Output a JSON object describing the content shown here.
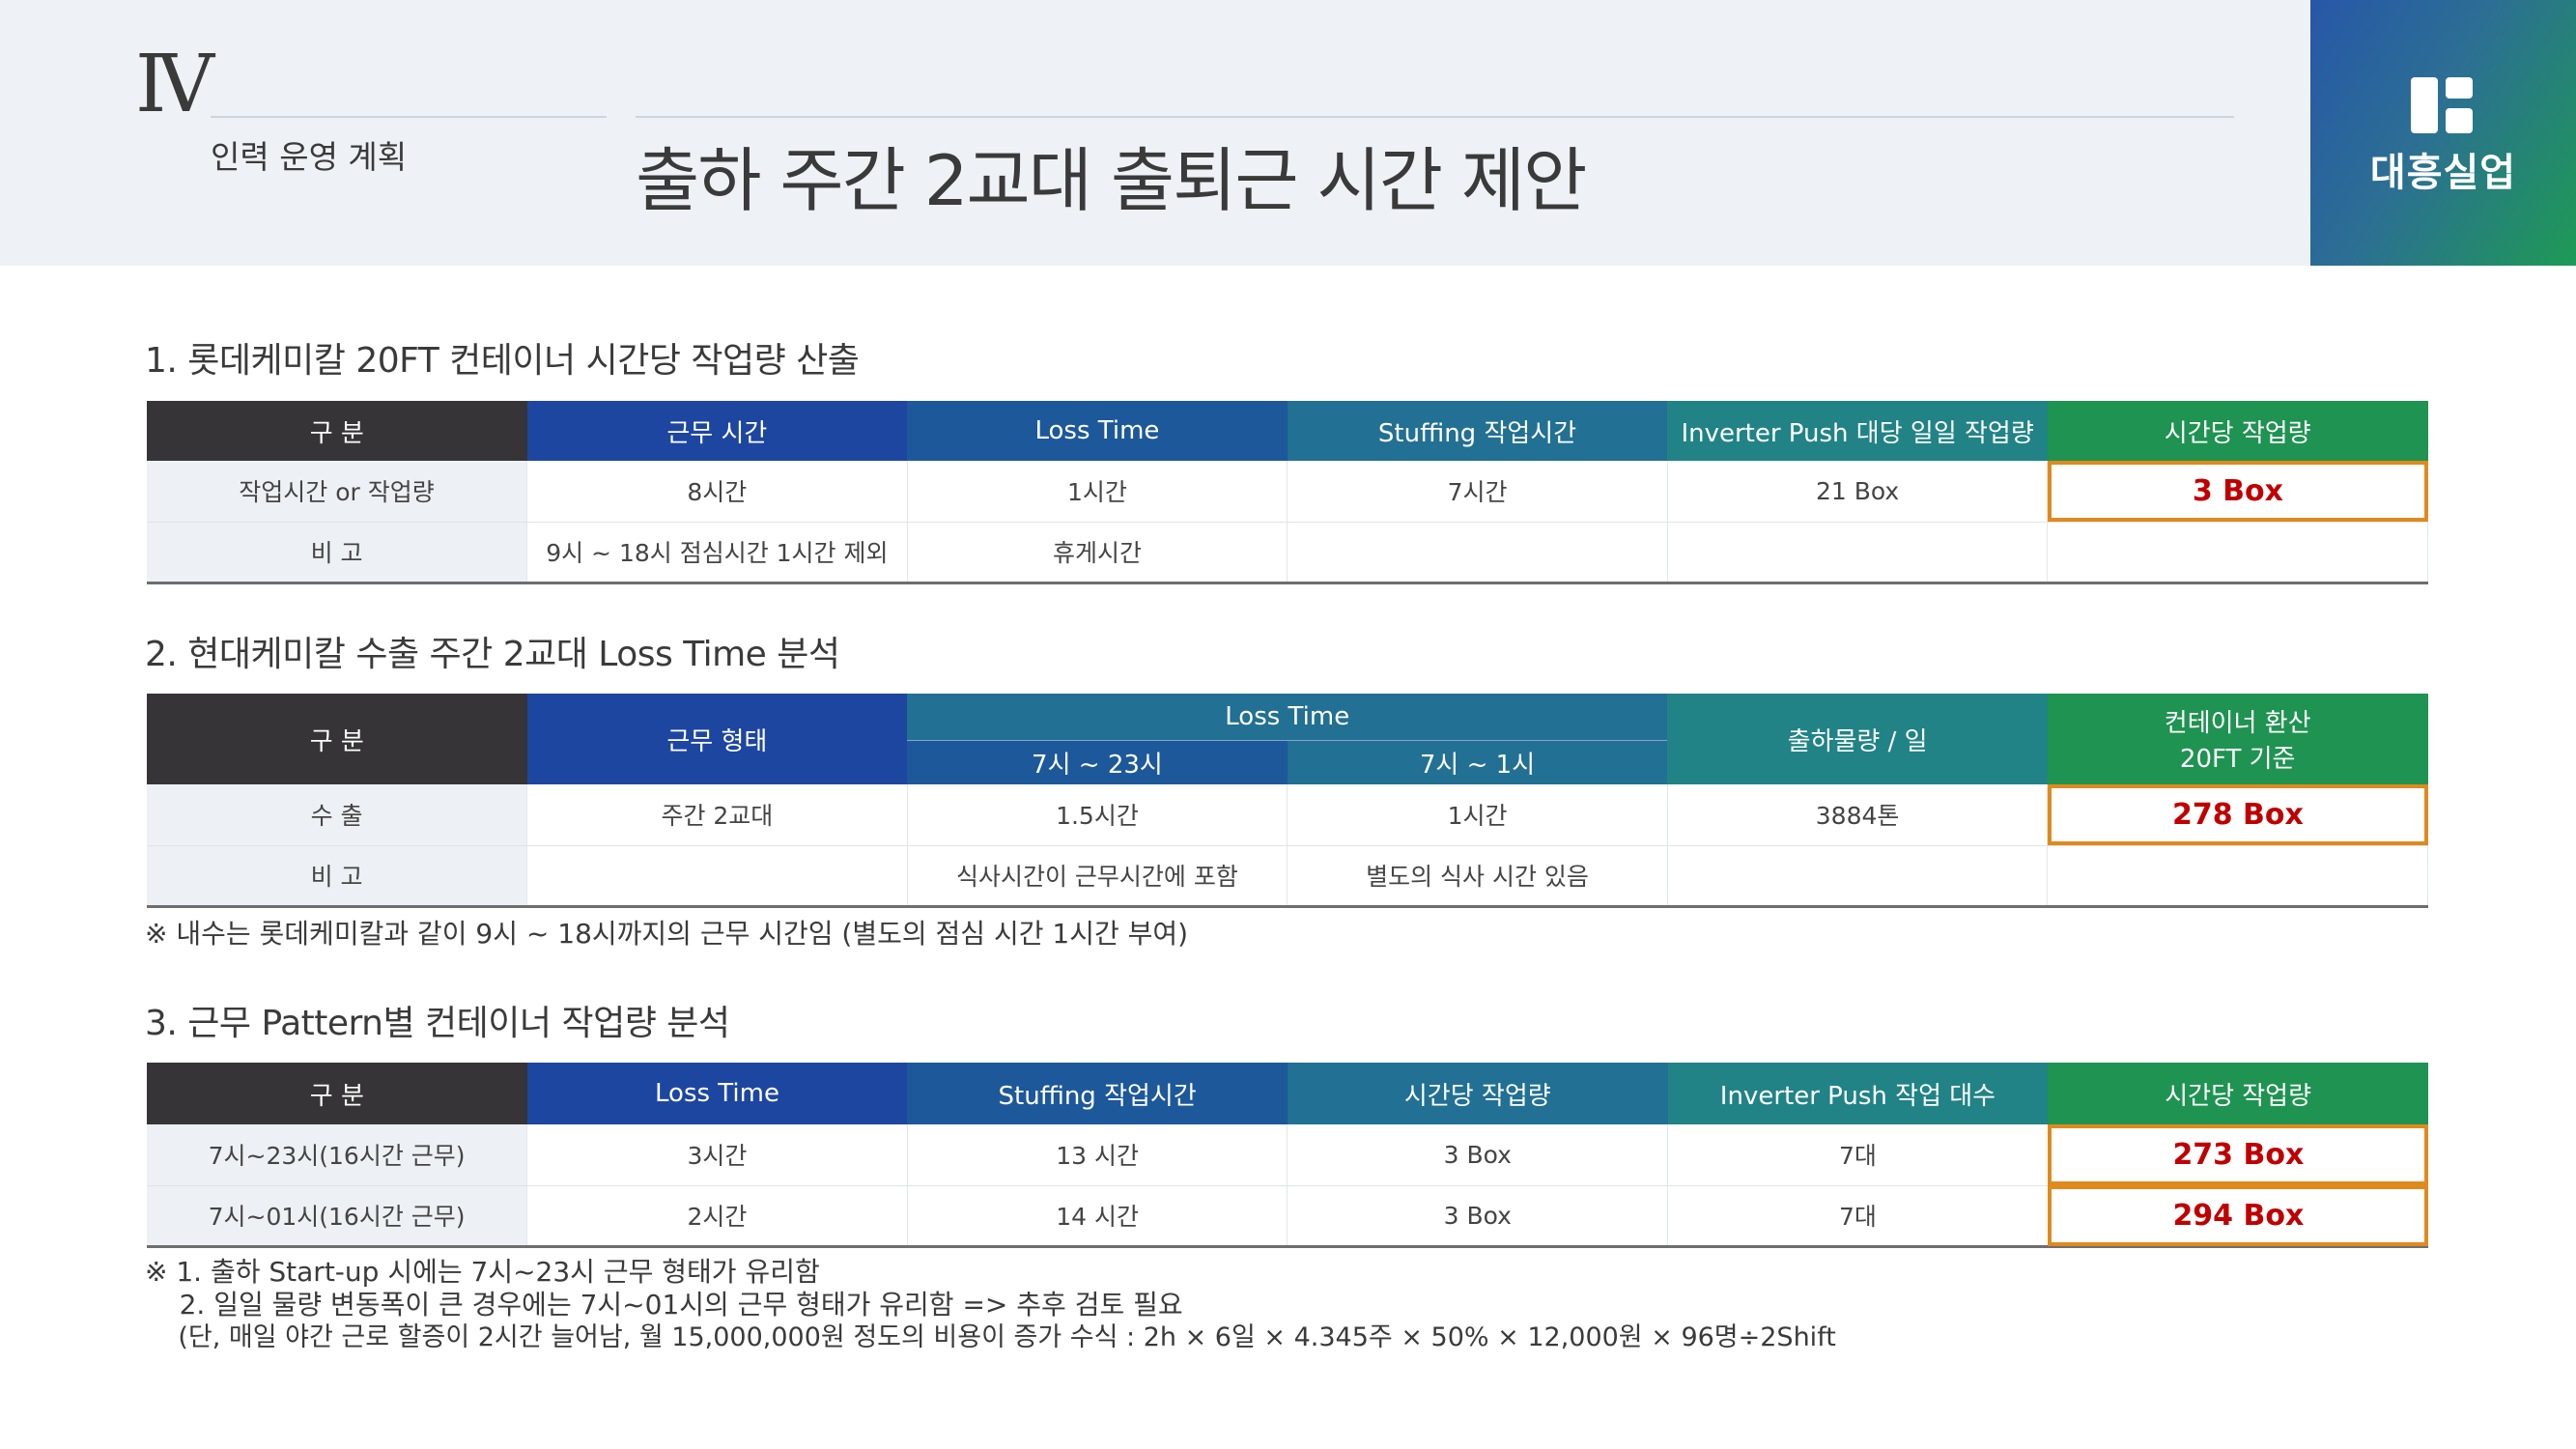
{
  "header": {
    "roman": "Ⅳ",
    "section": "인력 운영 계획",
    "title": "출하 주간 2교대 출퇴근 시간 제안",
    "logo_text": "대흥실업",
    "logo_icon": "daeheung-logo-icon"
  },
  "colors": {
    "header_dark": "#363436",
    "header_blue": "#1d46a0",
    "header_green": "#1f9351",
    "highlight_border": "#e08a1e",
    "highlight_text": "#c00000"
  },
  "section1": {
    "heading": "1. 롯데케미칼 20FT 컨테이너 시간당 작업량 산출",
    "columns": [
      "구 분",
      "근무 시간",
      "Loss Time",
      "Stuffing 작업시간",
      "Inverter Push 대당 일일 작업량",
      "시간당 작업량"
    ],
    "rows": [
      [
        "작업시간 or 작업량",
        "8시간",
        "1시간",
        "7시간",
        "21 Box",
        "3 Box"
      ],
      [
        "비 고",
        "9시 ~ 18시 점심시간 1시간 제외",
        "휴게시간",
        "",
        "",
        ""
      ]
    ]
  },
  "section2": {
    "heading": "2. 현대케미칼 수출 주간 2교대 Loss Time 분석",
    "col_label": "구 분",
    "col_work_type": "근무 형태",
    "col_loss_time": "Loss Time",
    "col_loss_a": "7시 ~ 23시",
    "col_loss_b": "7시 ~ 1시",
    "col_volume": "출하물량 / 일",
    "col_container_1": "컨테이너  환산",
    "col_container_2": "20FT 기준",
    "rows": [
      [
        "수 출",
        "주간 2교대",
        "1.5시간",
        "1시간",
        "3884톤",
        "278 Box"
      ],
      [
        "비 고",
        "",
        "식사시간이 근무시간에 포함",
        "별도의 식사 시간 있음",
        "",
        ""
      ]
    ],
    "note": "※ 내수는 롯데케미칼과 같이 9시 ~ 18시까지의 근무 시간임 (별도의 점심 시간 1시간 부여)"
  },
  "section3": {
    "heading": "3. 근무 Pattern별 컨테이너 작업량 분석",
    "columns": [
      "구 분",
      "Loss Time",
      "Stuffing 작업시간",
      "시간당 작업량",
      "Inverter Push 작업 대수",
      "시간당 작업량"
    ],
    "rows": [
      [
        "7시~23시(16시간 근무)",
        "3시간",
        "13 시간",
        "3 Box",
        "7대",
        "273 Box"
      ],
      [
        "7시~01시(16시간 근무)",
        "2시간",
        "14 시간",
        "3 Box",
        "7대",
        "294 Box"
      ]
    ],
    "notes": [
      "※ 1. 출하 Start-up 시에는 7시~23시 근무 형태가 유리함",
      "    2. 일일 물량 변동폭이 큰 경우에는 7시~01시의 근무 형태가 유리함 => 추후 검토 필요",
      "    (단, 매일 야간 근로 할증이 2시간 늘어남, 월 15,000,000원 정도의 비용이 증가 수식 : 2h × 6일 × 4.345주 × 50% × 12,000원 × 96명÷2Shift"
    ]
  }
}
